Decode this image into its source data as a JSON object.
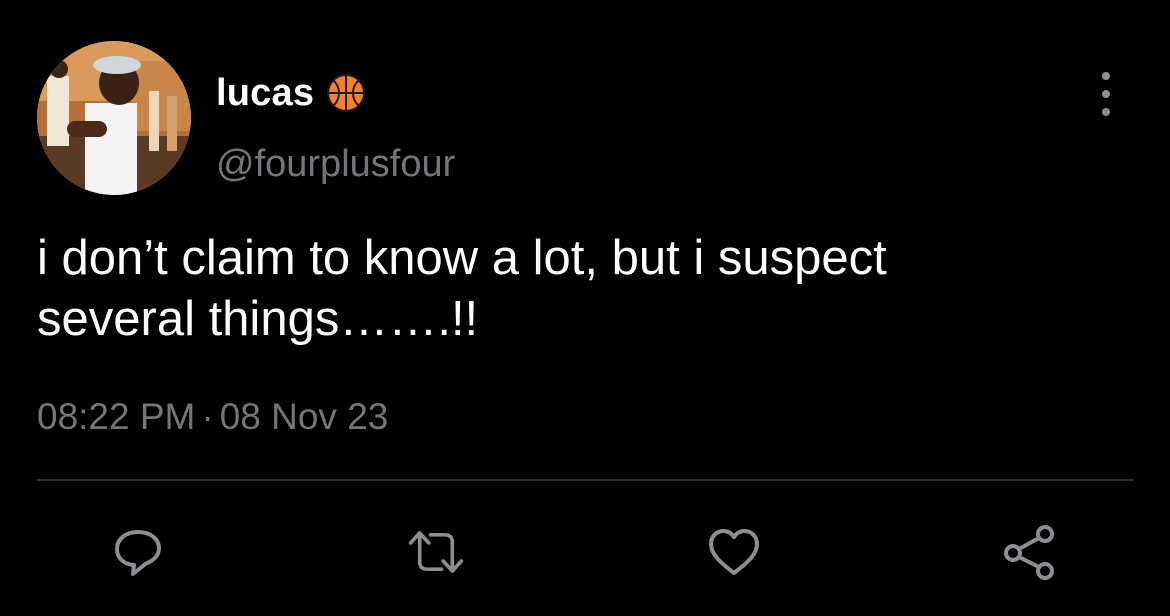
{
  "author": {
    "display_name": "lucas",
    "badge_icon": "basketball-icon",
    "handle": "@fourplusfour"
  },
  "tweet": {
    "text": "i don’t claim to know a lot, but i suspect\nseveral things…….!!",
    "time": "08:22 PM",
    "separator": "·",
    "date": "08 Nov 23"
  },
  "actions": {
    "reply_icon": "reply-icon",
    "retweet_icon": "retweet-icon",
    "like_icon": "heart-icon",
    "share_icon": "share-icon",
    "more_icon": "more-vertical-icon"
  },
  "colors": {
    "background": "#000000",
    "primary_text": "#ffffff",
    "secondary_text": "#71767b",
    "icon": "#8b8f94",
    "divider": "#2f3336",
    "badge_orange": "#f4812b"
  }
}
